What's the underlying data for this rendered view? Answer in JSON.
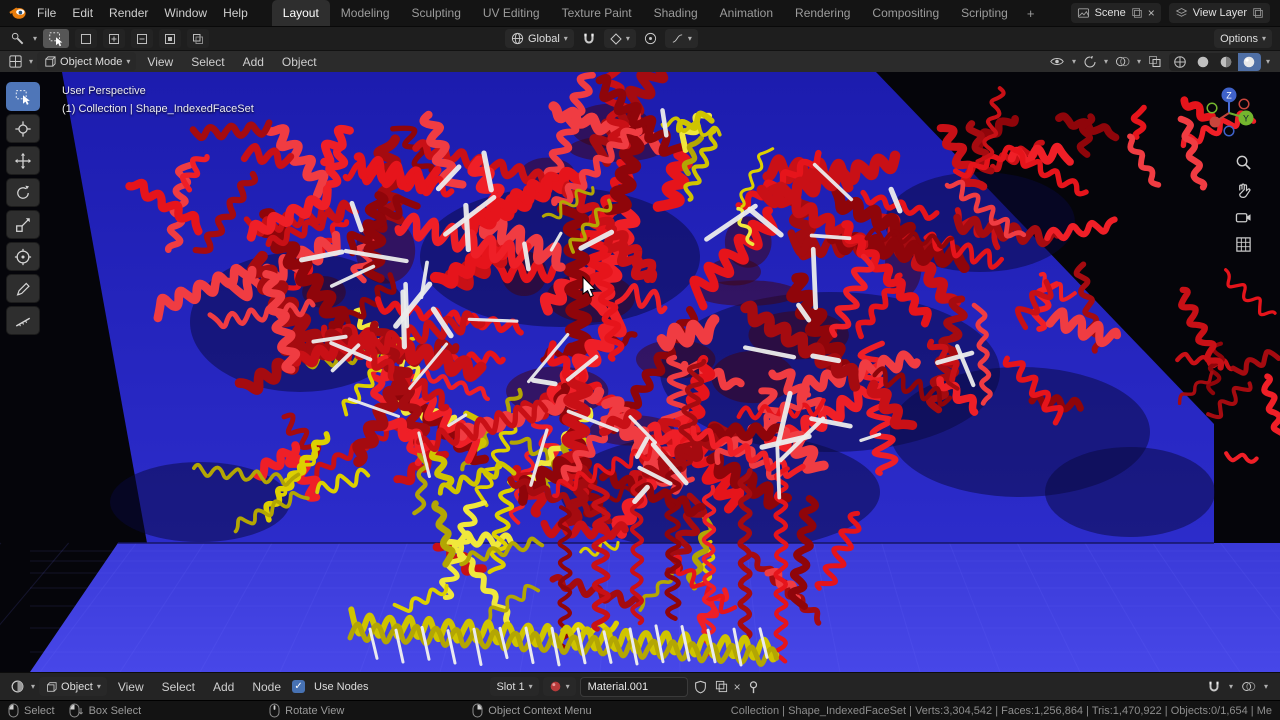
{
  "topbar": {
    "app_menus": [
      "File",
      "Edit",
      "Render",
      "Window",
      "Help"
    ],
    "workspace_tabs": [
      "Layout",
      "Modeling",
      "Sculpting",
      "UV Editing",
      "Texture Paint",
      "Shading",
      "Animation",
      "Rendering",
      "Compositing",
      "Scripting"
    ],
    "active_tab": "Layout",
    "new_workspace_label": "+",
    "scene_selector": {
      "value": "Scene"
    },
    "view_layer_selector": {
      "value": "View Layer"
    }
  },
  "tool_settings": {
    "orientation": {
      "value": "Global"
    },
    "options_label": "Options"
  },
  "viewport_header": {
    "mode": {
      "value": "Object Mode"
    },
    "menus": [
      "View",
      "Select",
      "Add",
      "Object"
    ]
  },
  "viewport": {
    "view_label": "User Perspective",
    "context_label": "(1) Collection | Shape_IndexedFaceSet",
    "gizmo_axes": {
      "z": "Z",
      "y": "Y"
    }
  },
  "shader_editor": {
    "id_type": {
      "value": "Object"
    },
    "menus": [
      "View",
      "Select",
      "Add",
      "Node"
    ],
    "use_nodes_label": "Use Nodes",
    "use_nodes_checked": true,
    "slot": {
      "value": "Slot 1"
    },
    "material_name": "Material.001"
  },
  "status_bar": {
    "hints": [
      {
        "mouse": "left",
        "label": "Select"
      },
      {
        "mouse": "left-drag",
        "label": "Box Select"
      },
      {
        "mouse": "middle",
        "label": "Rotate View"
      },
      {
        "mouse": "right",
        "label": "Object Context Menu"
      }
    ],
    "stats": "Collection | Shape_IndexedFaceSet | Verts:3,304,542 | Faces:1,256,864 | Tris:1,470,922 | Objects:0/1,654 | Me"
  },
  "glyphs": {
    "chevron": "▾",
    "close": "×",
    "check": "✓",
    "plus": "+"
  },
  "colors": {
    "accent": "#4772b3",
    "active_tool": "#4f76b8",
    "protein_red": "#e6141b",
    "protein_yellow": "#ddd000",
    "backdrop_blue": "#2323c0"
  }
}
